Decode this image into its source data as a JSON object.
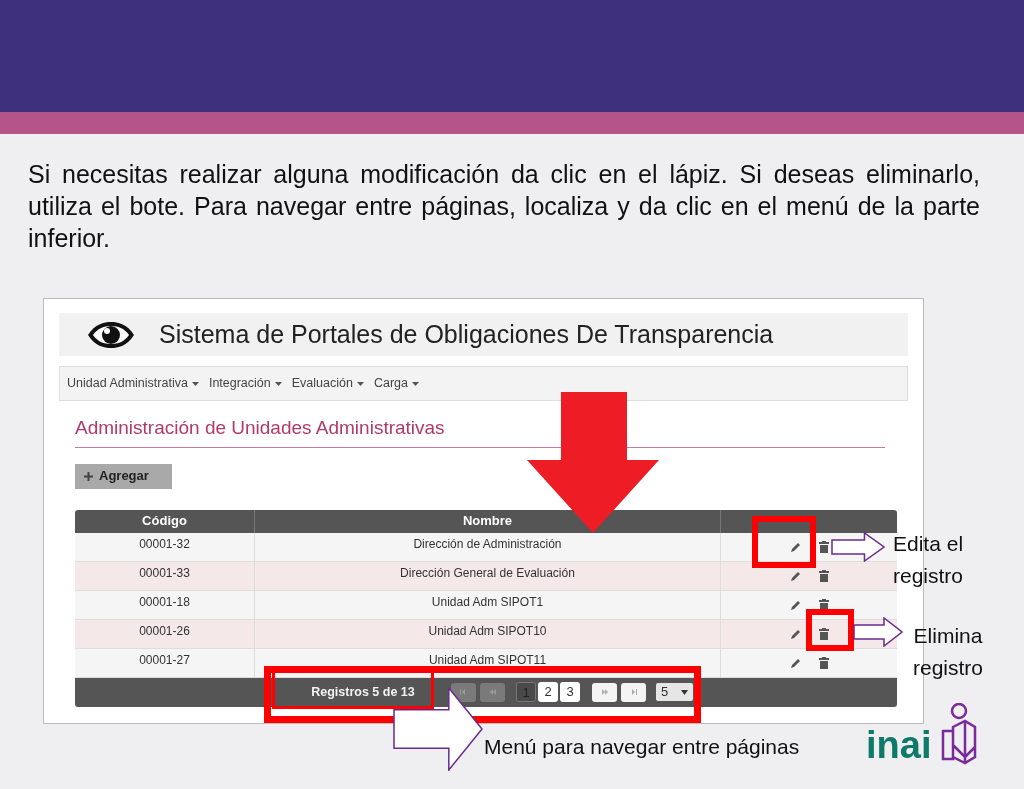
{
  "slide": {
    "instructions": "Si necesitas realizar alguna modificación da clic en el lápiz. Si deseas eliminarlo, utiliza el bote. Para navegar entre páginas, localiza y da clic en el menú de la parte inferior."
  },
  "app": {
    "title": "Sistema de Portales de Obligaciones De Transparencia",
    "menu": [
      {
        "label": "Unidad Administrativa"
      },
      {
        "label": "Integración"
      },
      {
        "label": "Evaluación"
      },
      {
        "label": "Carga"
      }
    ],
    "heading": "Administración de Unidades Administrativas",
    "add_button": "Agregar",
    "table": {
      "columns": [
        "Código",
        "Nombre"
      ],
      "rows": [
        {
          "codigo": "00001-32",
          "nombre": "Dirección de Administración"
        },
        {
          "codigo": "00001-33",
          "nombre": "Dirección General de Evaluación"
        },
        {
          "codigo": "00001-18",
          "nombre": "Unidad Adm SIPOT1"
        },
        {
          "codigo": "00001-26",
          "nombre": "Unidad Adm SIPOT10"
        },
        {
          "codigo": "00001-27",
          "nombre": "Unidad Adm SIPOT11"
        }
      ]
    },
    "pagination": {
      "records": "Registros 5 de 13",
      "nav": [
        {
          "kind": "first",
          "disabled": true
        },
        {
          "kind": "prev",
          "disabled": true
        }
      ],
      "pages": [
        {
          "label": "1",
          "selected": true
        },
        {
          "label": "2",
          "selected": false
        },
        {
          "label": "3",
          "selected": false
        }
      ],
      "nav_after": [
        {
          "kind": "next",
          "disabled": false
        },
        {
          "kind": "last",
          "disabled": false
        }
      ],
      "page_size": "5"
    }
  },
  "callouts": [
    {
      "text": "Edita el registro"
    },
    {
      "text": "Elimina registro"
    },
    {
      "text": "Menú para navegar entre páginas"
    }
  ],
  "logo": {
    "text": "inai"
  }
}
